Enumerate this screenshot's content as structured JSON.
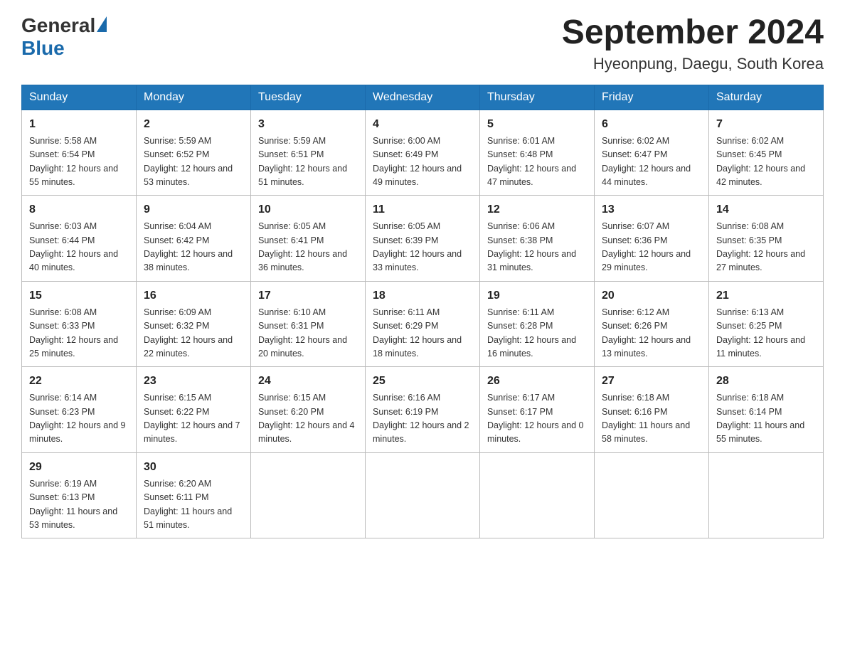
{
  "header": {
    "logo_general": "General",
    "logo_blue": "Blue",
    "title": "September 2024",
    "subtitle": "Hyeonpung, Daegu, South Korea"
  },
  "weekdays": [
    "Sunday",
    "Monday",
    "Tuesday",
    "Wednesday",
    "Thursday",
    "Friday",
    "Saturday"
  ],
  "weeks": [
    [
      {
        "day": "1",
        "sunrise": "5:58 AM",
        "sunset": "6:54 PM",
        "daylight": "12 hours and 55 minutes."
      },
      {
        "day": "2",
        "sunrise": "5:59 AM",
        "sunset": "6:52 PM",
        "daylight": "12 hours and 53 minutes."
      },
      {
        "day": "3",
        "sunrise": "5:59 AM",
        "sunset": "6:51 PM",
        "daylight": "12 hours and 51 minutes."
      },
      {
        "day": "4",
        "sunrise": "6:00 AM",
        "sunset": "6:49 PM",
        "daylight": "12 hours and 49 minutes."
      },
      {
        "day": "5",
        "sunrise": "6:01 AM",
        "sunset": "6:48 PM",
        "daylight": "12 hours and 47 minutes."
      },
      {
        "day": "6",
        "sunrise": "6:02 AM",
        "sunset": "6:47 PM",
        "daylight": "12 hours and 44 minutes."
      },
      {
        "day": "7",
        "sunrise": "6:02 AM",
        "sunset": "6:45 PM",
        "daylight": "12 hours and 42 minutes."
      }
    ],
    [
      {
        "day": "8",
        "sunrise": "6:03 AM",
        "sunset": "6:44 PM",
        "daylight": "12 hours and 40 minutes."
      },
      {
        "day": "9",
        "sunrise": "6:04 AM",
        "sunset": "6:42 PM",
        "daylight": "12 hours and 38 minutes."
      },
      {
        "day": "10",
        "sunrise": "6:05 AM",
        "sunset": "6:41 PM",
        "daylight": "12 hours and 36 minutes."
      },
      {
        "day": "11",
        "sunrise": "6:05 AM",
        "sunset": "6:39 PM",
        "daylight": "12 hours and 33 minutes."
      },
      {
        "day": "12",
        "sunrise": "6:06 AM",
        "sunset": "6:38 PM",
        "daylight": "12 hours and 31 minutes."
      },
      {
        "day": "13",
        "sunrise": "6:07 AM",
        "sunset": "6:36 PM",
        "daylight": "12 hours and 29 minutes."
      },
      {
        "day": "14",
        "sunrise": "6:08 AM",
        "sunset": "6:35 PM",
        "daylight": "12 hours and 27 minutes."
      }
    ],
    [
      {
        "day": "15",
        "sunrise": "6:08 AM",
        "sunset": "6:33 PM",
        "daylight": "12 hours and 25 minutes."
      },
      {
        "day": "16",
        "sunrise": "6:09 AM",
        "sunset": "6:32 PM",
        "daylight": "12 hours and 22 minutes."
      },
      {
        "day": "17",
        "sunrise": "6:10 AM",
        "sunset": "6:31 PM",
        "daylight": "12 hours and 20 minutes."
      },
      {
        "day": "18",
        "sunrise": "6:11 AM",
        "sunset": "6:29 PM",
        "daylight": "12 hours and 18 minutes."
      },
      {
        "day": "19",
        "sunrise": "6:11 AM",
        "sunset": "6:28 PM",
        "daylight": "12 hours and 16 minutes."
      },
      {
        "day": "20",
        "sunrise": "6:12 AM",
        "sunset": "6:26 PM",
        "daylight": "12 hours and 13 minutes."
      },
      {
        "day": "21",
        "sunrise": "6:13 AM",
        "sunset": "6:25 PM",
        "daylight": "12 hours and 11 minutes."
      }
    ],
    [
      {
        "day": "22",
        "sunrise": "6:14 AM",
        "sunset": "6:23 PM",
        "daylight": "12 hours and 9 minutes."
      },
      {
        "day": "23",
        "sunrise": "6:15 AM",
        "sunset": "6:22 PM",
        "daylight": "12 hours and 7 minutes."
      },
      {
        "day": "24",
        "sunrise": "6:15 AM",
        "sunset": "6:20 PM",
        "daylight": "12 hours and 4 minutes."
      },
      {
        "day": "25",
        "sunrise": "6:16 AM",
        "sunset": "6:19 PM",
        "daylight": "12 hours and 2 minutes."
      },
      {
        "day": "26",
        "sunrise": "6:17 AM",
        "sunset": "6:17 PM",
        "daylight": "12 hours and 0 minutes."
      },
      {
        "day": "27",
        "sunrise": "6:18 AM",
        "sunset": "6:16 PM",
        "daylight": "11 hours and 58 minutes."
      },
      {
        "day": "28",
        "sunrise": "6:18 AM",
        "sunset": "6:14 PM",
        "daylight": "11 hours and 55 minutes."
      }
    ],
    [
      {
        "day": "29",
        "sunrise": "6:19 AM",
        "sunset": "6:13 PM",
        "daylight": "11 hours and 53 minutes."
      },
      {
        "day": "30",
        "sunrise": "6:20 AM",
        "sunset": "6:11 PM",
        "daylight": "11 hours and 51 minutes."
      },
      null,
      null,
      null,
      null,
      null
    ]
  ]
}
